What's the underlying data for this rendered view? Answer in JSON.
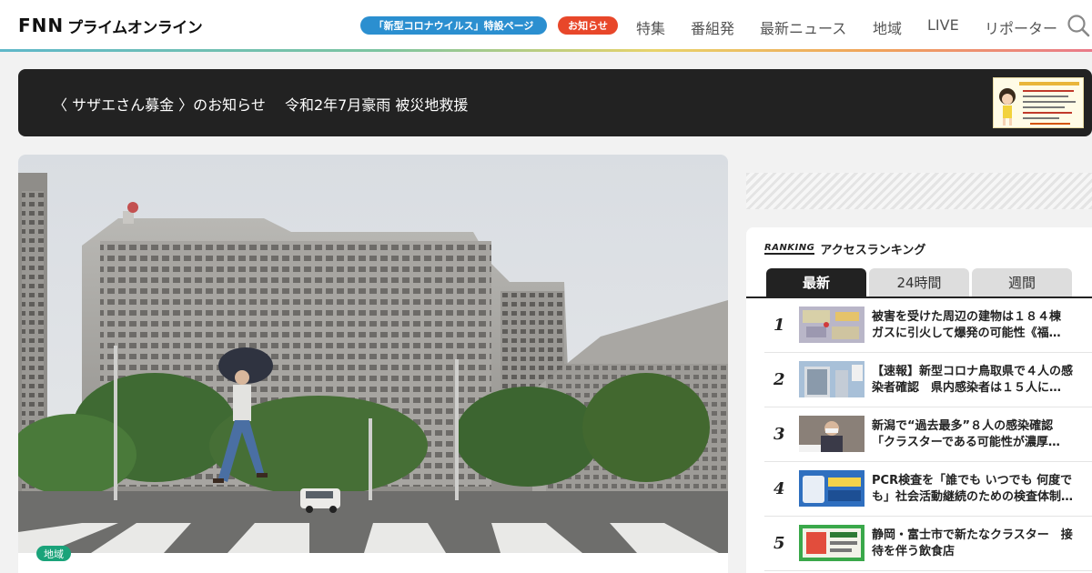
{
  "header": {
    "logo_fnn": "FNN",
    "logo_text": "プライムオンライン",
    "pill_corona": "「新型コロナウイルス」特設ページ",
    "pill_notice": "お知らせ",
    "nav": [
      "特集",
      "番組発",
      "最新ニュース",
      "地域",
      "LIVE",
      "リポーター"
    ],
    "search_icon": "search-icon",
    "accent_colors": {
      "corona_pill": "#2b8fd0",
      "notice_pill": "#e8472a",
      "fnn_green": "#1aa37a"
    }
  },
  "banner": {
    "text": "〈 サザエさん募金 〉のお知らせ　 令和2年7月豪雨 被災地救援"
  },
  "main_article": {
    "category": "地域"
  },
  "ranking": {
    "logo": "RANKING",
    "title": "アクセスランキング",
    "tabs": [
      "最新",
      "24時間",
      "週間"
    ],
    "active_tab": "最新",
    "items": [
      {
        "rank": "1",
        "title": "被害を受けた周辺の建物は１８４棟 ガスに引火して爆発の可能性《福…"
      },
      {
        "rank": "2",
        "title": "【速報】新型コロナ鳥取県で４人の感染者確認　県内感染者は１５人に…"
      },
      {
        "rank": "3",
        "title": "新潟で“過去最多”８人の感染確認「クラスターである可能性が濃厚…"
      },
      {
        "rank": "4",
        "title": "PCR検査を「誰でも いつでも 何度でも」社会活動継続のための検査体制…"
      },
      {
        "rank": "5",
        "title": "静岡・富士市で新たなクラスター　接待を伴う飲食店"
      }
    ]
  }
}
